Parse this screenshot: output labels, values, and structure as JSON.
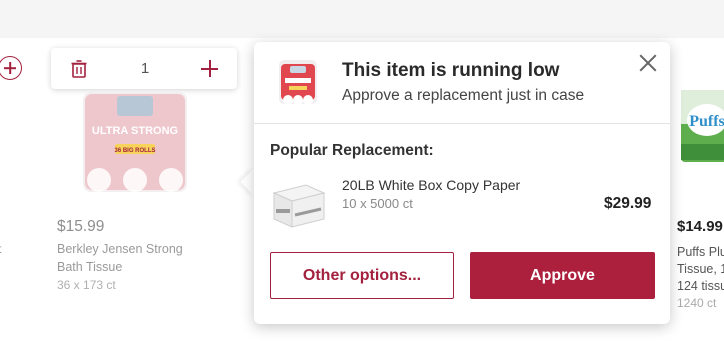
{
  "colors": {
    "accent": "#ac1f3d",
    "accent_outline": "#a3213f"
  },
  "left_product": {
    "quantity": "1",
    "price": "$15.99",
    "name_line1": "Berkley Jensen Strong",
    "name_line2": "Bath Tissue",
    "meta": "36 x 173 ct",
    "image_text": "ULTRA STRONG",
    "image_badge": "36 BIG ROLLS",
    "icons": {
      "remove": "trash-icon",
      "increase": "plus-icon",
      "add": "circle-plus-icon"
    }
  },
  "left_cut_text": "t",
  "right_product": {
    "price": "$14.99",
    "name_line1": "Puffs Plu",
    "name_line2": "Tissue, 1",
    "name_line3": "124 tissu",
    "meta": "1240 ct",
    "image_text": "Puffs"
  },
  "popup": {
    "title": "This item is running low",
    "subtitle": "Approve a replacement just in case",
    "section_label": "Popular Replacement:",
    "close_icon": "close-icon",
    "replacement": {
      "name": "20LB White Box Copy Paper",
      "size": "10 x 5000 ct",
      "price": "$29.99"
    },
    "buttons": {
      "other": "Other options...",
      "approve": "Approve"
    }
  }
}
